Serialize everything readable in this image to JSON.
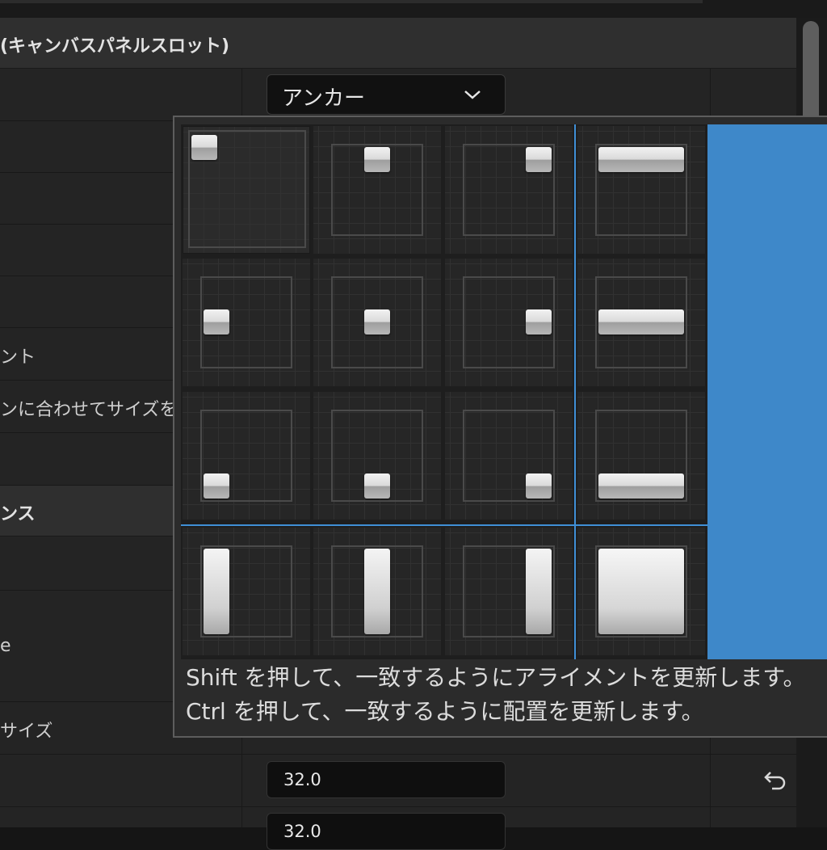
{
  "section_canvas_slot": {
    "title": "(キャンバスパネルスロット)"
  },
  "rows": {
    "anchor": {
      "dropdown_value": "アンカー"
    },
    "row_text_1": "ント",
    "row_text_2": "ンに合わせてサイズを",
    "row_text_3": "e",
    "row_text_4": "サイズ"
  },
  "section_2": {
    "title": "ンス"
  },
  "fields": {
    "value_1": "32.0",
    "value_2": "32.0"
  },
  "anchor_popup": {
    "hint_line_1": "Shift を押して、一致するようにアライメントを更新します。",
    "hint_line_2": "Ctrl を押して、一致するように配置を更新します。",
    "selected_preset": "top-left"
  },
  "colors": {
    "accent_blue": "#3e88c9",
    "divider_blue": "#3f8fd6",
    "panel_bg": "#242424"
  }
}
